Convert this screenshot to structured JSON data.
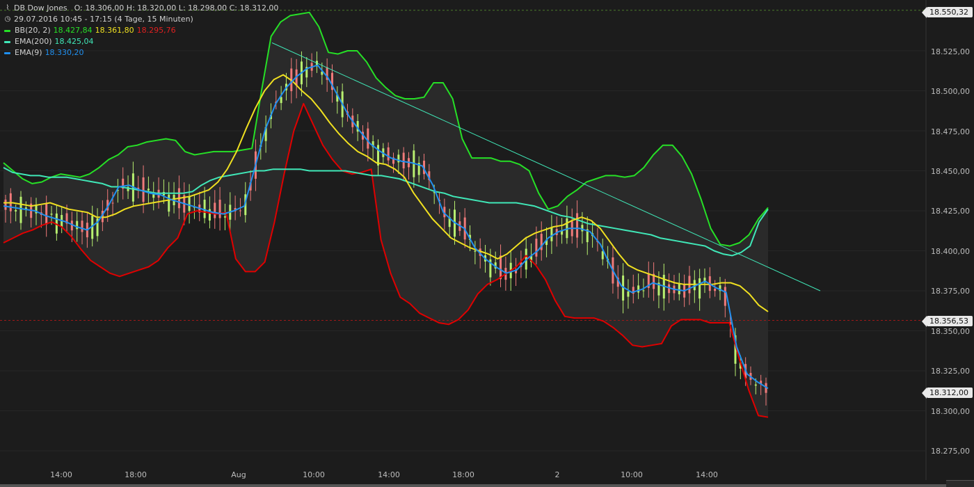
{
  "legend": {
    "title": "DB Dow Jones",
    "ohlc": "O: 18.306,00   H: 18.320,00   L: 18.298,00   C: 18.312,00",
    "range": "29.07.2016 10:45 - 17:15 (4 Tage, 15 Minuten)",
    "bb_label": "BB(20, 2)",
    "bb_upper": "18.427,84",
    "bb_mid": "18.361,80",
    "bb_lower": "18.295,76",
    "ema200_label": "EMA(200)",
    "ema200_value": "18.425,04",
    "ema9_label": "EMA(9)",
    "ema9_value": "18.330,20"
  },
  "y_axis": {
    "ticks": [
      "18.550,32",
      "18.525,00",
      "18.500,00",
      "18.475,00",
      "18.450,00",
      "18.425,00",
      "18.400,00",
      "18.375,00",
      "18.350,00",
      "18.325,00",
      "18.300,00",
      "18.275,00"
    ]
  },
  "x_axis": {
    "ticks": [
      "14:00",
      "18:00",
      "Aug",
      "10:00",
      "14:00",
      "18:00",
      "2",
      "10:00",
      "14:00"
    ]
  },
  "price_tags": {
    "high": "18.550,32",
    "reference": "18.356,53",
    "last": "18.312,00"
  },
  "colors": {
    "background": "#1c1c1c",
    "bb_upper_lower": "#26e026",
    "bb_lower": "#e00000",
    "bb_mid": "#f0e020",
    "ema200": "#40e8b8",
    "ema9": "#2090f0",
    "trendline": "#40e8b8",
    "candle_up": "#b8f070",
    "candle_down": "#f07a7a"
  },
  "chart_data": {
    "type": "candlestick",
    "symbol": "DB Dow Jones",
    "interval": "15 Minuten",
    "ylim": [
      18265,
      18555
    ],
    "x_ticks": [
      "14:00",
      "18:00",
      "Aug",
      "10:00",
      "14:00",
      "18:00",
      "2",
      "10:00",
      "14:00"
    ],
    "high_marker": 18550.32,
    "reference_level": 18356.53,
    "last_close": 18312.0,
    "indicators": {
      "bb_upper": [
        18455,
        18450,
        18445,
        18442,
        18443,
        18446,
        18448,
        18447,
        18446,
        18448,
        18452,
        18457,
        18460,
        18465,
        18466,
        18468,
        18469,
        18470,
        18469,
        18462,
        18460,
        18461,
        18462,
        18462,
        18462,
        18463,
        18464,
        18500,
        18534,
        18543,
        18547,
        18548,
        18549,
        18540,
        18524,
        18523,
        18525,
        18525,
        18518,
        18508,
        18502,
        18497,
        18495,
        18495,
        18496,
        18505,
        18505,
        18495,
        18470,
        18458,
        18458,
        18458,
        18456,
        18456,
        18454,
        18450,
        18436,
        18426,
        18428,
        18434,
        18438,
        18443,
        18445,
        18447,
        18447,
        18446,
        18447,
        18452,
        18460,
        18466,
        18466,
        18459,
        18448,
        18432,
        18414,
        18404,
        18403,
        18405,
        18410,
        18420,
        18427
      ],
      "bb_mid": [
        18430,
        18430,
        18429,
        18428,
        18429,
        18430,
        18428,
        18426,
        18425,
        18424,
        18421,
        18421,
        18423,
        18426,
        18428,
        18429,
        18430,
        18431,
        18432,
        18433,
        18434,
        18436,
        18438,
        18443,
        18451,
        18462,
        18476,
        18489,
        18500,
        18507,
        18510,
        18506,
        18500,
        18495,
        18488,
        18480,
        18473,
        18467,
        18462,
        18459,
        18455,
        18454,
        18451,
        18446,
        18436,
        18428,
        18420,
        18414,
        18408,
        18405,
        18402,
        18400,
        18398,
        18395,
        18398,
        18403,
        18408,
        18411,
        18413,
        18415,
        18416,
        18419,
        18421,
        18419,
        18414,
        18406,
        18398,
        18391,
        18388,
        18386,
        18384,
        18382,
        18380,
        18379,
        18379,
        18379,
        18379,
        18380,
        18380,
        18378,
        18373,
        18366,
        18362
      ],
      "bb_lower": [
        18405,
        18408,
        18411,
        18413,
        18416,
        18418,
        18415,
        18409,
        18401,
        18394,
        18390,
        18386,
        18384,
        18386,
        18388,
        18390,
        18394,
        18402,
        18408,
        18423,
        18425,
        18424,
        18423,
        18424,
        18395,
        18387,
        18387,
        18393,
        18418,
        18448,
        18475,
        18492,
        18479,
        18466,
        18457,
        18450,
        18448,
        18449,
        18451,
        18407,
        18386,
        18371,
        18367,
        18361,
        18358,
        18355,
        18354,
        18357,
        18363,
        18373,
        18379,
        18382,
        18386,
        18390,
        18397,
        18391,
        18382,
        18369,
        18359,
        18358,
        18358,
        18358,
        18356,
        18352,
        18347,
        18341,
        18340,
        18341,
        18342,
        18353,
        18357,
        18357,
        18357,
        18355,
        18355,
        18355,
        18333,
        18313,
        18297,
        18296
      ],
      "ema200": [
        18452,
        18449,
        18448,
        18447,
        18447,
        18446,
        18446,
        18446,
        18445,
        18444,
        18443,
        18442,
        18440,
        18440,
        18439,
        18438,
        18437,
        18436,
        18436,
        18436,
        18436,
        18437,
        18441,
        18444,
        18446,
        18447,
        18448,
        18449,
        18450,
        18450,
        18451,
        18451,
        18451,
        18451,
        18450,
        18450,
        18450,
        18450,
        18450,
        18449,
        18448,
        18447,
        18447,
        18446,
        18445,
        18443,
        18441,
        18439,
        18437,
        18436,
        18434,
        18433,
        18432,
        18431,
        18430,
        18430,
        18430,
        18430,
        18429,
        18428,
        18426,
        18424,
        18422,
        18421,
        18419,
        18417,
        18416,
        18415,
        18414,
        18413,
        18412,
        18411,
        18410,
        18408,
        18407,
        18406,
        18405,
        18404,
        18403,
        18400,
        18398,
        18397,
        18399,
        18403,
        18418,
        18426
      ],
      "ema9": [
        18428,
        18427,
        18426,
        18425,
        18422,
        18420,
        18418,
        18415,
        18413,
        18418,
        18428,
        18440,
        18441,
        18438,
        18436,
        18435,
        18432,
        18430,
        18428,
        18426,
        18424,
        18423,
        18425,
        18428,
        18452,
        18476,
        18492,
        18502,
        18509,
        18514,
        18516,
        18508,
        18496,
        18484,
        18475,
        18467,
        18462,
        18458,
        18456,
        18455,
        18453,
        18441,
        18424,
        18418,
        18414,
        18402,
        18395,
        18390,
        18386,
        18388,
        18395,
        18400,
        18408,
        18412,
        18414,
        18414,
        18412,
        18404,
        18390,
        18378,
        18374,
        18376,
        18380,
        18378,
        18376,
        18375,
        18378,
        18381,
        18377,
        18374,
        18340,
        18323,
        18318,
        18314
      ]
    },
    "trendline": {
      "from": 18530,
      "to": 18375
    }
  }
}
